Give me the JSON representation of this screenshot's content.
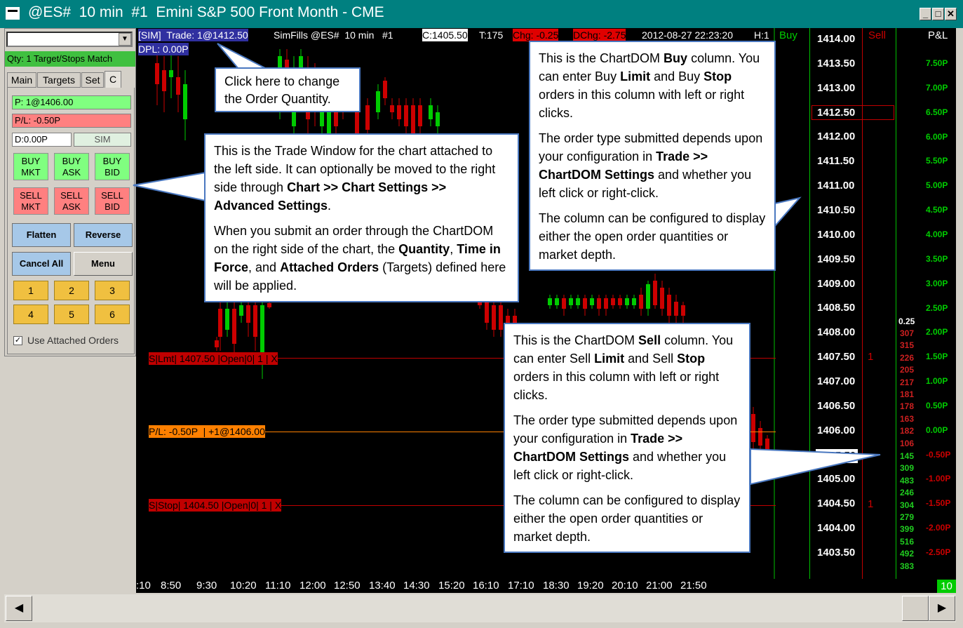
{
  "window": {
    "title": "@ES#  10 min  #1  Emini S&P 500 Front Month - CME"
  },
  "left_panel": {
    "dropdown_value": "",
    "qty_status": "Qty: 1 Target/Stops Match",
    "tabs": [
      "Main",
      "Targets",
      "Set",
      "C"
    ],
    "position": "P: 1@1406.00",
    "pl": "P/L: -0.50P",
    "daily": "D:0.00P",
    "mode": "SIM",
    "buttons": {
      "buy_mkt": "BUY MKT",
      "buy_ask": "BUY ASK",
      "buy_bid": "BUY BID",
      "sell_mkt": "SELL MKT",
      "sell_ask": "SELL ASK",
      "sell_bid": "SELL BID",
      "flatten": "Flatten",
      "reverse": "Reverse",
      "cancel_all": "Cancel All",
      "menu": "Menu"
    },
    "qty_buttons": [
      "1",
      "2",
      "3",
      "4",
      "5",
      "6"
    ],
    "use_attached": "Use Attached Orders"
  },
  "chart_header": {
    "sim": "[SIM]",
    "trade": "Trade: 1@1412.50",
    "fills": "SimFills @ES#  10 min   #1",
    "close": "C:1405.50",
    "ticks": "T:175",
    "chg": "Chg: -0.25",
    "dchg": "DChg: -2.75",
    "datetime": "2012-08-27 22:23:20",
    "h": "H:1",
    "dpl": "DPL: 0.00P"
  },
  "order_lines": {
    "limit": "S|Lmt| 1407.50 |Open|0| 1 | X",
    "pl": "P/L: -0.50P  | +1@1406.00",
    "stop": "S|Stop| 1404.50 |Open|0| 1 | X"
  },
  "dom": {
    "buy_header": "Buy",
    "sell_header": "Sell",
    "pl_header": "P&L",
    "prices": [
      "1414.00",
      "1413.50",
      "1413.00",
      "1412.50",
      "1412.00",
      "1411.50",
      "1411.00",
      "1410.50",
      "1410.00",
      "1409.50",
      "1409.00",
      "1408.50",
      "1408.00",
      "1407.50",
      "1407.00",
      "1406.50",
      "1406.00",
      "1405.50",
      "1405.00",
      "1404.50",
      "1404.00",
      "1403.50"
    ],
    "pnl": [
      "7.50P",
      "7.00P",
      "6.50P",
      "6.00P",
      "5.50P",
      "5.00P",
      "4.50P",
      "4.00P",
      "3.50P",
      "3.00P",
      "2.50P",
      "2.00P",
      "1.50P",
      "1.00P",
      "0.50P",
      "0.00P",
      "-0.50P",
      "-1.00P",
      "-1.50P",
      "-2.00P",
      "-2.50P"
    ],
    "sell_orders": [
      "1",
      "1"
    ],
    "tick_size": "0.25",
    "ask_depth": [
      "307",
      "315",
      "226",
      "205",
      "217",
      "181",
      "178",
      "163",
      "182",
      "106"
    ],
    "bid_depth": [
      "145",
      "309",
      "483",
      "246",
      "304",
      "279",
      "399",
      "516",
      "492",
      "383"
    ],
    "current_price": "1405.50",
    "counter": "10"
  },
  "time_axis": [
    ":10",
    "8:50",
    "9:30",
    "10:20",
    "11:10",
    "12:00",
    "12:50",
    "13:40",
    "14:30",
    "15:20",
    "16:10",
    "17:10",
    "18:30",
    "19:20",
    "20:10",
    "21:00",
    "21:50"
  ],
  "callouts": {
    "order_qty": "Click here to change the Order Quantity.",
    "trade_window_1a": "This is the Trade Window for the chart attached to the left side. It can optionally be moved to the right side through ",
    "trade_window_1b": "Chart >> Chart Settings >> Advanced Settings",
    "trade_window_1c": ".",
    "trade_window_2a": "When you submit an order through the ChartDOM on the right side of the chart, the ",
    "trade_window_2b": "Quantity",
    "trade_window_2c": ", ",
    "trade_window_2d": "Time in Force",
    "trade_window_2e": ", and ",
    "trade_window_2f": "Attached Orders",
    "trade_window_2g": " (Targets) defined here will be applied.",
    "buy_1a": "This is the ChartDOM ",
    "buy_1b": "Buy",
    "buy_1c": " column. You can enter Buy ",
    "buy_1d": "Limit",
    "buy_1e": " and Buy ",
    "buy_1f": "Stop",
    "buy_1g": " orders in this column with left or right clicks.",
    "buy_2a": "The order type submitted depends upon your configuration in ",
    "buy_2b": "Trade >> ChartDOM Settings",
    "buy_2c": " and whether you left click or right-click.",
    "buy_3": "The column can be configured to display either the open order quantities or market depth.",
    "sell_1a": "This is the ChartDOM ",
    "sell_1b": "Sell",
    "sell_1c": " column. You can enter Sell ",
    "sell_1d": "Limit",
    "sell_1e": " and Sell ",
    "sell_1f": "Stop",
    "sell_1g": " orders in this column with left or right clicks.",
    "sell_2a": "The order type submitted depends upon your configuration in ",
    "sell_2b": "Trade >> ChartDOM Settings",
    "sell_2c": " and whether you left click or right-click.",
    "sell_3": "The column can be configured to display either the open order quantities or market depth."
  },
  "colors": {
    "titlebar": "#008080",
    "buy_green": "#00cc00",
    "sell_red": "#cc0000",
    "accent_blue": "#4a78c0"
  }
}
